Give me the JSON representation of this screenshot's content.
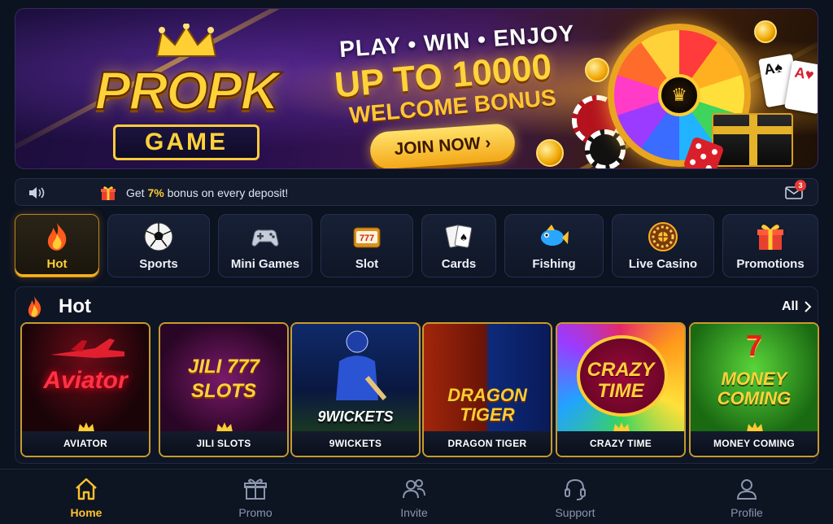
{
  "banner": {
    "logo_main": "PROPK",
    "logo_sub": "GAME",
    "tagline": "PLAY • WIN • ENJOY",
    "headline": "UP TO 10000",
    "subheadline": "WELCOME BONUS",
    "cta_label": "JOIN NOW ›"
  },
  "notice": {
    "prefix": "Get ",
    "highlight": "7%",
    "suffix": " bonus on every deposit!",
    "mail_badge": "3"
  },
  "categories": [
    {
      "label": "Hot",
      "icon": "fire-icon",
      "active": true
    },
    {
      "label": "Sports",
      "icon": "soccer-ball-icon"
    },
    {
      "label": "Mini Games",
      "icon": "gamepad-icon"
    },
    {
      "label": "Slot",
      "icon": "slot-machine-icon"
    },
    {
      "label": "Cards",
      "icon": "playing-cards-icon"
    },
    {
      "label": "Fishing",
      "icon": "fish-icon"
    },
    {
      "label": "Live Casino",
      "icon": "roulette-icon"
    },
    {
      "label": "Promotions",
      "icon": "gift-icon"
    }
  ],
  "hot": {
    "title": "Hot",
    "all_label": "All",
    "games": [
      {
        "name": "AVIATOR",
        "art_text": "Aviator"
      },
      {
        "name": "JILI SLOTS",
        "art_text": "JILI 777 SLOTS"
      },
      {
        "name": "9WICKETS",
        "art_text": "9WICKETS"
      },
      {
        "name": "DRAGON TIGER",
        "art_text": "DRAGON TIGER"
      },
      {
        "name": "CRAZY TIME",
        "art_text": "CRAZY TIME"
      },
      {
        "name": "MONEY COMING",
        "art_text": "MONEY COMING"
      }
    ]
  },
  "nav": [
    {
      "label": "Home",
      "active": true
    },
    {
      "label": "Promo"
    },
    {
      "label": "Invite"
    },
    {
      "label": "Support"
    },
    {
      "label": "Profile"
    }
  ],
  "colors": {
    "accent": "#ffc22e",
    "background": "#0b1220",
    "badge": "#e53935"
  }
}
